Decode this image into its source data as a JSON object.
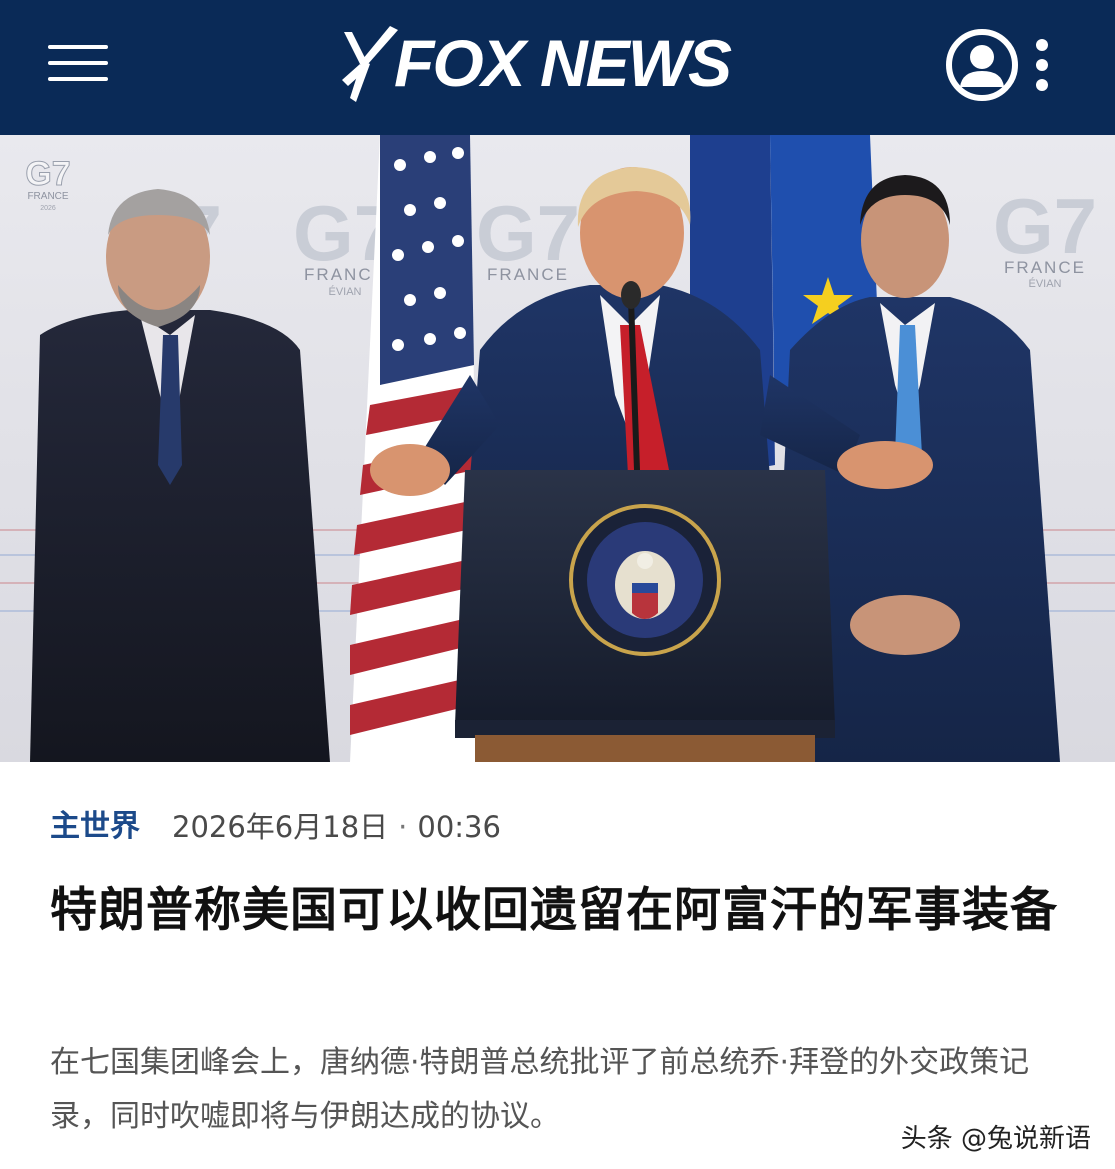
{
  "header": {
    "brand": "FOX NEWS",
    "background_color": "#0a2a57",
    "menu_icon": "hamburger-menu-icon",
    "account_icon": "user-account-icon",
    "more_icon": "more-vertical-icon"
  },
  "hero": {
    "backdrop_logo": "G7",
    "backdrop_country": "FRANCE",
    "backdrop_city": "ÉVIAN",
    "backdrop_year": "2026"
  },
  "article": {
    "section": "主世界",
    "date": "2026年6月18日",
    "separator": "·",
    "time": "00:36",
    "headline": "特朗普称美国可以收回遗留在阿富汗的军事装备",
    "summary": "在七国集团峰会上，唐纳德·特朗普总统批评了前总统乔·拜登的外交政策记录，同时吹嘘即将与伊朗达成的协议。",
    "section_color": "#1c4a8a"
  },
  "watermark": "头条 @兔说新语"
}
